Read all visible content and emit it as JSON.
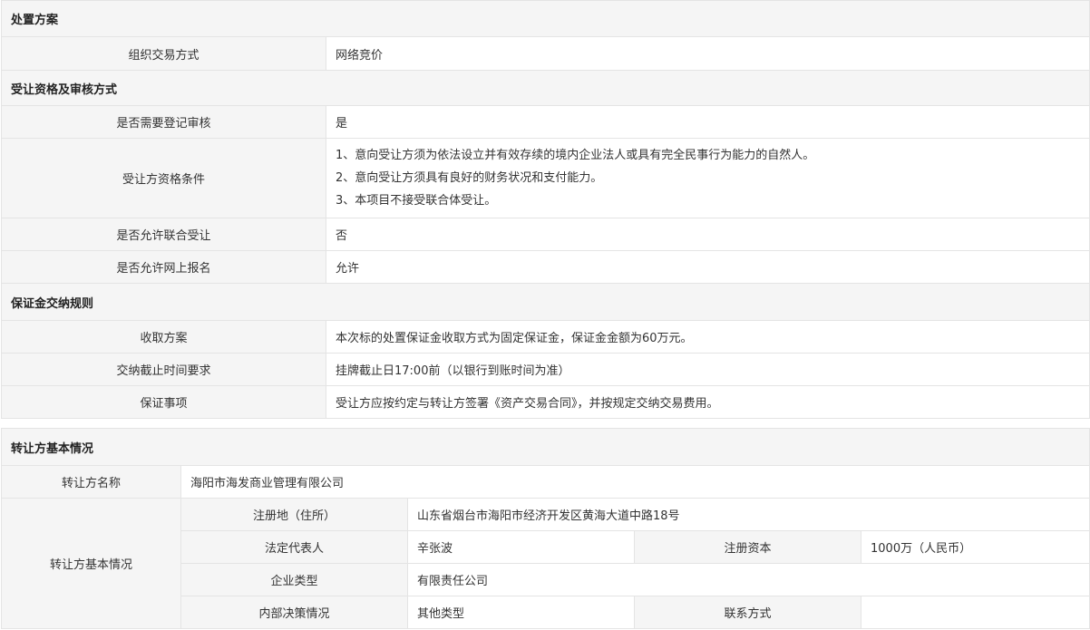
{
  "disposal": {
    "title": "处置方案",
    "method_label": "组织交易方式",
    "method_value": "网络竞价"
  },
  "qualification": {
    "title": "受让资格及审核方式",
    "rows": [
      {
        "label": "是否需要登记审核",
        "value": "是"
      },
      {
        "label": "是否允许联合受让",
        "value": "否"
      },
      {
        "label": "是否允许网上报名",
        "value": "允许"
      }
    ],
    "conditions_label": "受让方资格条件",
    "conditions": [
      "1、意向受让方须为依法设立并有效存续的境内企业法人或具有完全民事行为能力的自然人。",
      "2、意向受让方须具有良好的财务状况和支付能力。",
      "3、本项目不接受联合体受让。"
    ]
  },
  "deposit": {
    "title": "保证金交纳规则",
    "rows": [
      {
        "label": "收取方案",
        "value": "本次标的处置保证金收取方式为固定保证金，保证金金额为60万元。"
      },
      {
        "label": "交纳截止时间要求",
        "value": "挂牌截止日17:00前（以银行到账时间为准）"
      },
      {
        "label": "保证事项",
        "value": "受让方应按约定与转让方签署《资产交易合同》，并按规定交纳交易费用。"
      }
    ]
  },
  "transferor": {
    "title": "转让方基本情况",
    "name_label": "转让方名称",
    "name_value": "海阳市海发商业管理有限公司",
    "basic_label": "转让方基本情况",
    "address_label": "注册地（住所）",
    "address_value": "山东省烟台市海阳市经济开发区黄海大道中路18号",
    "legal_rep_label": "法定代表人",
    "legal_rep_value": "辛张波",
    "capital_label": "注册资本",
    "capital_value": "1000万（人民币）",
    "company_type_label": "企业类型",
    "company_type_value": "有限责任公司",
    "decision_label": "内部决策情况",
    "decision_value": "其他类型",
    "contact_label": "联系方式",
    "contact_value": ""
  }
}
